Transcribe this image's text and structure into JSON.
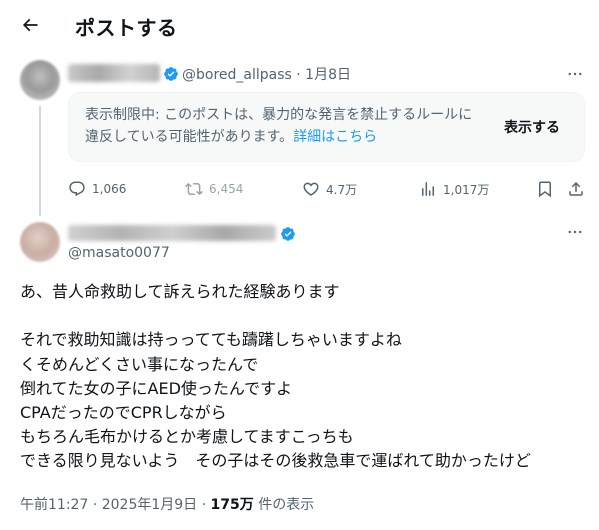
{
  "header": {
    "title": "ポストする"
  },
  "parent_post": {
    "handle": "@bored_allpass",
    "separator": "·",
    "date": "1月8日",
    "notice": {
      "text": "表示制限中: このポストは、暴力的な発言を禁止するルールに違反している可能性があります。",
      "link_text": "詳細はこちら",
      "show_button": "表示する"
    },
    "actions": {
      "replies": "1,066",
      "reposts": "6,454",
      "likes": "4.7万",
      "views": "1,017万"
    }
  },
  "reply_post": {
    "handle": "@masato0077",
    "body_lines": [
      "あ、昔人命救助して訴えられた経験あります",
      "",
      "それで救助知識は持っってても躊躇しちゃいますよね",
      "くそめんどくさい事になったんで",
      "倒れてた女の子にAED使ったんですよ",
      "CPAだったのでCPRしながら",
      "もちろん毛布かけるとか考慮してますこっちも",
      "できる限り見ないよう　その子はその後救急車で運ばれて助かったけど"
    ],
    "footer": {
      "time": "午前11:27",
      "separator1": "·",
      "date": "2025年1月9日",
      "separator2": "·",
      "views_count": "175万",
      "views_label": "件の表示"
    }
  },
  "colors": {
    "accent": "#1d9bf0",
    "text_primary": "#0f1419",
    "text_secondary": "#536471",
    "notice_bg": "#f7f9f9",
    "thread_line": "#cfd9de"
  },
  "icons": {
    "back": "arrow-left-icon",
    "verified": "verified-badge-icon",
    "more": "more-horizontal-icon",
    "reply": "reply-bubble-icon",
    "repost": "repost-icon",
    "like": "heart-icon",
    "views": "views-bar-chart-icon",
    "bookmark": "bookmark-icon",
    "share": "share-icon"
  }
}
